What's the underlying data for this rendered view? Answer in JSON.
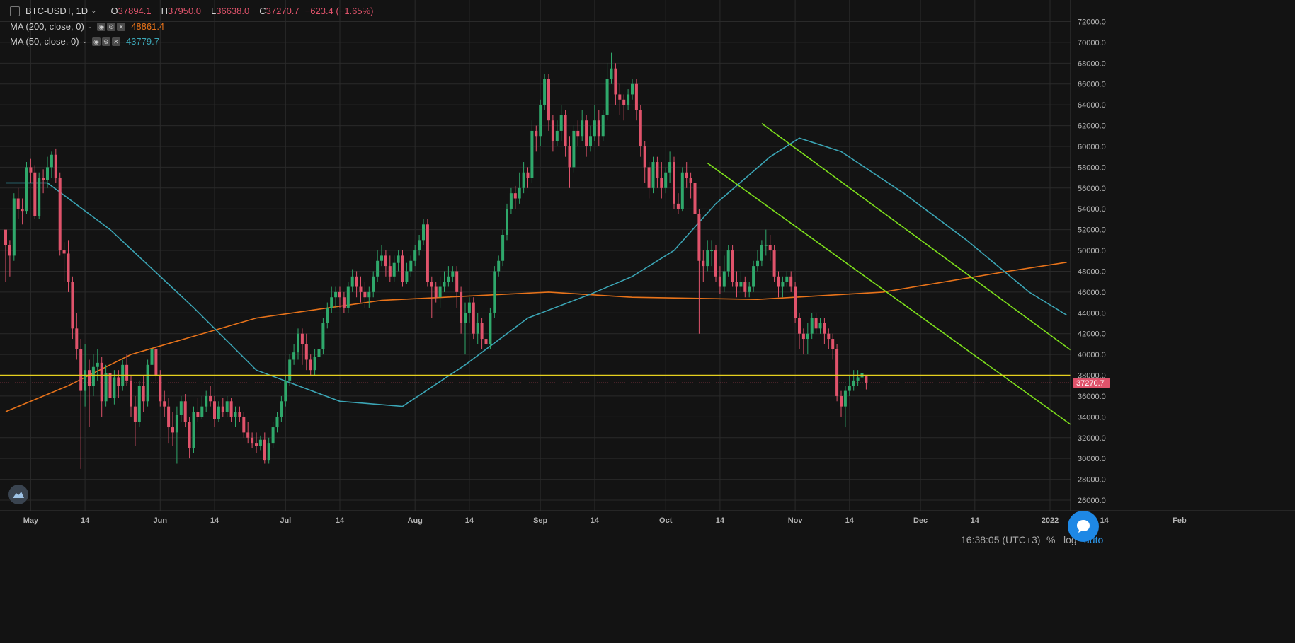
{
  "header": {
    "symbol": "BTC-USDT, 1D",
    "chevron": "⌄",
    "o_label": "O",
    "o_value": "37894.1",
    "h_label": "H",
    "h_value": "37950.0",
    "l_label": "L",
    "l_value": "36638.0",
    "c_label": "C",
    "c_value": "37270.7",
    "change": "−623.4 (−1.65%)"
  },
  "indicators": [
    {
      "name": "MA (200, close, 0)",
      "value": "48861.4",
      "color": "#e8731a"
    },
    {
      "name": "MA (50, close, 0)",
      "value": "43779.7",
      "color": "#3ba5b5"
    }
  ],
  "footer": {
    "time": "16:38:05 (UTC+3)",
    "percent": "%",
    "log": "log",
    "auto": "auto"
  },
  "chart_data": {
    "type": "candlestick",
    "symbol": "BTC-USDT",
    "interval": "1D",
    "ylim": [
      25000,
      73000
    ],
    "y_ticks": [
      "26000.0",
      "28000.0",
      "30000.0",
      "32000.0",
      "34000.0",
      "36000.0",
      "38000.0",
      "40000.0",
      "42000.0",
      "44000.0",
      "46000.0",
      "48000.0",
      "50000.0",
      "52000.0",
      "54000.0",
      "56000.0",
      "58000.0",
      "60000.0",
      "62000.0",
      "64000.0",
      "66000.0",
      "68000.0",
      "70000.0",
      "72000.0"
    ],
    "x_ticks": [
      "May",
      "14",
      "Jun",
      "14",
      "Jul",
      "14",
      "Aug",
      "14",
      "Sep",
      "14",
      "Oct",
      "14",
      "Nov",
      "14",
      "Dec",
      "14",
      "2022",
      "14",
      "Feb"
    ],
    "grid": true,
    "last_price_label": "37270.7",
    "last_price": 37270.7,
    "horizontal_level": 38000,
    "up_color": "#2fa86b",
    "down_color": "#e0536b",
    "candles": [
      [
        52000,
        50500,
        51800,
        47000
      ],
      [
        50500,
        49500,
        51000,
        47500
      ],
      [
        49500,
        55000,
        55500,
        49000
      ],
      [
        55000,
        54000,
        56000,
        53000
      ],
      [
        54000,
        53800,
        55000,
        52500
      ],
      [
        53800,
        58000,
        58500,
        53500
      ],
      [
        58000,
        57500,
        58800,
        56500
      ],
      [
        57500,
        53300,
        58200,
        53000
      ],
      [
        53300,
        57000,
        57500,
        53000
      ],
      [
        57000,
        56800,
        57800,
        55500
      ],
      [
        56800,
        58000,
        59000,
        56000
      ],
      [
        58000,
        59200,
        59500,
        57000
      ],
      [
        59200,
        57000,
        59800,
        56500
      ],
      [
        57000,
        50000,
        57500,
        49500
      ],
      [
        50000,
        49700,
        50800,
        47000
      ],
      [
        49700,
        47000,
        51000,
        46000
      ],
      [
        47000,
        42500,
        47500,
        41500
      ],
      [
        42500,
        40500,
        44000,
        39500
      ],
      [
        40500,
        36500,
        41500,
        29000
      ],
      [
        36500,
        38500,
        41000,
        35000
      ],
      [
        38500,
        37000,
        39500,
        33000
      ],
      [
        37000,
        38800,
        40000,
        36000
      ],
      [
        38800,
        39200,
        40500,
        37500
      ],
      [
        39200,
        35500,
        39800,
        34000
      ],
      [
        35500,
        38200,
        39000,
        35000
      ],
      [
        38200,
        35800,
        39000,
        35000
      ],
      [
        35800,
        37800,
        38500,
        35200
      ],
      [
        37800,
        37000,
        38500,
        35800
      ],
      [
        37000,
        39000,
        39500,
        36500
      ],
      [
        39000,
        37500,
        40000,
        37000
      ],
      [
        37500,
        35000,
        38000,
        34000
      ],
      [
        35000,
        33500,
        36000,
        31200
      ],
      [
        33500,
        37000,
        37500,
        33000
      ],
      [
        37000,
        35500,
        38000,
        34500
      ],
      [
        35500,
        39000,
        39500,
        35000
      ],
      [
        39000,
        40500,
        41000,
        38000
      ],
      [
        40500,
        38000,
        40800,
        37500
      ],
      [
        38000,
        35500,
        38500,
        35000
      ],
      [
        35500,
        35000,
        36500,
        34000
      ],
      [
        35000,
        33000,
        35800,
        31500
      ],
      [
        33000,
        32500,
        34500,
        31200
      ],
      [
        32500,
        34200,
        35000,
        29500
      ],
      [
        34200,
        35500,
        36000,
        33500
      ],
      [
        35500,
        33500,
        36200,
        33000
      ],
      [
        33500,
        31000,
        34000,
        30000
      ],
      [
        31000,
        34500,
        35000,
        30500
      ],
      [
        34500,
        34000,
        35800,
        33500
      ],
      [
        34000,
        35000,
        36000,
        33800
      ],
      [
        35000,
        36000,
        36500,
        34500
      ],
      [
        36000,
        35500,
        37000,
        35000
      ],
      [
        35500,
        33800,
        36000,
        33000
      ],
      [
        33800,
        35000,
        35500,
        33500
      ],
      [
        35000,
        34500,
        35800,
        34000
      ],
      [
        34500,
        35500,
        36000,
        34000
      ],
      [
        35500,
        34000,
        35800,
        33500
      ],
      [
        34000,
        34500,
        35000,
        33000
      ],
      [
        34500,
        34000,
        35000,
        33500
      ],
      [
        34000,
        32500,
        34500,
        32000
      ],
      [
        32500,
        32000,
        33500,
        31500
      ],
      [
        32000,
        31500,
        32500,
        31000
      ],
      [
        31500,
        31200,
        32500,
        30500
      ],
      [
        31200,
        31800,
        32200,
        30800
      ],
      [
        31800,
        29800,
        32500,
        29500
      ],
      [
        29800,
        31500,
        32000,
        29500
      ],
      [
        31500,
        33000,
        33500,
        31000
      ],
      [
        33000,
        34000,
        34500,
        32500
      ],
      [
        34000,
        35500,
        36000,
        33500
      ],
      [
        35500,
        37500,
        38000,
        35000
      ],
      [
        37500,
        39500,
        40000,
        37000
      ],
      [
        39500,
        40200,
        41000,
        39000
      ],
      [
        40200,
        42000,
        42500,
        39500
      ],
      [
        42000,
        41000,
        42500,
        39000
      ],
      [
        41000,
        39500,
        42000,
        38500
      ],
      [
        39500,
        38500,
        40000,
        38000
      ],
      [
        38500,
        39800,
        40500,
        38000
      ],
      [
        39800,
        40500,
        41000,
        37500
      ],
      [
        40500,
        43000,
        43500,
        40000
      ],
      [
        43000,
        44500,
        45000,
        42500
      ],
      [
        44500,
        45500,
        46500,
        44000
      ],
      [
        45500,
        46000,
        46500,
        44500
      ],
      [
        46000,
        45500,
        46500,
        44500
      ],
      [
        45500,
        44500,
        46000,
        44000
      ],
      [
        44500,
        46500,
        47000,
        44000
      ],
      [
        46500,
        47500,
        48200,
        46000
      ],
      [
        47500,
        46500,
        48000,
        45500
      ],
      [
        46500,
        46000,
        47500,
        45000
      ],
      [
        46000,
        45500,
        47000,
        44500
      ],
      [
        45500,
        46000,
        46500,
        44500
      ],
      [
        46000,
        47500,
        48000,
        45500
      ],
      [
        47500,
        49000,
        50000,
        47000
      ],
      [
        49000,
        49500,
        50500,
        48500
      ],
      [
        49500,
        48500,
        50000,
        47500
      ],
      [
        48500,
        47500,
        49500,
        47000
      ],
      [
        47500,
        48800,
        49500,
        47000
      ],
      [
        48800,
        49500,
        50000,
        48000
      ],
      [
        49500,
        47000,
        50000,
        46500
      ],
      [
        47000,
        48000,
        48800,
        46800
      ],
      [
        48000,
        49000,
        49500,
        47500
      ],
      [
        49000,
        50000,
        50500,
        48500
      ],
      [
        50000,
        51000,
        51500,
        49500
      ],
      [
        51000,
        52500,
        53000,
        50500
      ],
      [
        52500,
        47000,
        53000,
        46500
      ],
      [
        47000,
        46500,
        47500,
        43500
      ],
      [
        46500,
        45500,
        47000,
        45000
      ],
      [
        45500,
        46500,
        47500,
        44500
      ],
      [
        46500,
        47000,
        48000,
        46000
      ],
      [
        47000,
        47500,
        48500,
        46500
      ],
      [
        47500,
        48000,
        48500,
        47000
      ],
      [
        48000,
        46000,
        48500,
        44500
      ],
      [
        46000,
        43000,
        46500,
        42000
      ],
      [
        43000,
        44000,
        45000,
        40000
      ],
      [
        44000,
        45000,
        45500,
        43000
      ],
      [
        45000,
        42000,
        45500,
        41500
      ],
      [
        42000,
        43000,
        44000,
        41000
      ],
      [
        43000,
        41500,
        43500,
        40500
      ],
      [
        41500,
        41000,
        42500,
        40500
      ],
      [
        41000,
        44000,
        44500,
        40500
      ],
      [
        44000,
        48000,
        48500,
        43500
      ],
      [
        48000,
        49000,
        49500,
        47500
      ],
      [
        49000,
        51500,
        52000,
        48500
      ],
      [
        51500,
        54000,
        54500,
        51000
      ],
      [
        54000,
        55500,
        56000,
        53500
      ],
      [
        55500,
        55000,
        56200,
        54000
      ],
      [
        55000,
        56000,
        57500,
        54500
      ],
      [
        56000,
        57500,
        58500,
        55500
      ],
      [
        57500,
        57000,
        58000,
        56000
      ],
      [
        57000,
        61500,
        62500,
        56500
      ],
      [
        61500,
        61000,
        62000,
        59500
      ],
      [
        61000,
        64000,
        64500,
        60000
      ],
      [
        64000,
        66500,
        67000,
        63500
      ],
      [
        66500,
        62500,
        67000,
        61500
      ],
      [
        62500,
        60500,
        63000,
        59500
      ],
      [
        60500,
        61500,
        62500,
        60000
      ],
      [
        61500,
        63000,
        64000,
        60500
      ],
      [
        63000,
        60000,
        63500,
        59000
      ],
      [
        60000,
        58000,
        61000,
        56000
      ],
      [
        58000,
        61500,
        62000,
        57500
      ],
      [
        61500,
        61000,
        62500,
        60000
      ],
      [
        61000,
        62500,
        63500,
        60500
      ],
      [
        62500,
        60000,
        63000,
        59000
      ],
      [
        60000,
        61000,
        62000,
        59500
      ],
      [
        61000,
        62500,
        64000,
        60500
      ],
      [
        62500,
        61000,
        63500,
        60000
      ],
      [
        61000,
        63000,
        63500,
        60500
      ],
      [
        63000,
        66500,
        68000,
        62500
      ],
      [
        66500,
        67500,
        69000,
        66000
      ],
      [
        67500,
        65000,
        68000,
        64000
      ],
      [
        65000,
        64500,
        66000,
        63000
      ],
      [
        64500,
        64000,
        65000,
        62500
      ],
      [
        64000,
        65000,
        65500,
        63500
      ],
      [
        65000,
        66000,
        66500,
        64500
      ],
      [
        66000,
        63500,
        66500,
        62500
      ],
      [
        63500,
        60000,
        64000,
        59000
      ],
      [
        60000,
        58000,
        60500,
        56500
      ],
      [
        58000,
        56000,
        58500,
        55000
      ],
      [
        56000,
        58500,
        59000,
        55500
      ],
      [
        58500,
        57000,
        59000,
        56000
      ],
      [
        57000,
        56000,
        58500,
        55000
      ],
      [
        56000,
        57500,
        58000,
        55500
      ],
      [
        57500,
        58500,
        59500,
        56500
      ],
      [
        58500,
        54500,
        59000,
        54000
      ],
      [
        54500,
        54000,
        55500,
        53500
      ],
      [
        54000,
        57500,
        58000,
        53800
      ],
      [
        57500,
        57000,
        58500,
        56000
      ],
      [
        57000,
        56500,
        57500,
        55000
      ],
      [
        56500,
        53500,
        57000,
        52000
      ],
      [
        53500,
        49000,
        54000,
        42000
      ],
      [
        49000,
        48500,
        50000,
        47000
      ],
      [
        48500,
        50000,
        51000,
        48000
      ],
      [
        50000,
        50000,
        51000,
        48500
      ],
      [
        50000,
        47500,
        50500,
        47000
      ],
      [
        47500,
        46500,
        48500,
        45800
      ],
      [
        46500,
        48000,
        49500,
        46000
      ],
      [
        48000,
        50000,
        50500,
        47500
      ],
      [
        50000,
        47000,
        50500,
        46500
      ],
      [
        47000,
        46500,
        48000,
        45500
      ],
      [
        46500,
        47000,
        48000,
        46000
      ],
      [
        47000,
        46000,
        47500,
        45500
      ],
      [
        46000,
        46500,
        47000,
        45500
      ],
      [
        46500,
        48500,
        49000,
        46000
      ],
      [
        48500,
        49000,
        50000,
        48000
      ],
      [
        49000,
        50500,
        51000,
        48500
      ],
      [
        50500,
        50500,
        52000,
        49500
      ],
      [
        50500,
        50000,
        51500,
        49000
      ],
      [
        50000,
        47500,
        50500,
        47000
      ],
      [
        47500,
        46500,
        48000,
        45500
      ],
      [
        46500,
        47000,
        47500,
        45500
      ],
      [
        47000,
        47500,
        48000,
        46500
      ],
      [
        47500,
        46500,
        48000,
        46000
      ],
      [
        46500,
        43500,
        47000,
        43000
      ],
      [
        43500,
        42000,
        44000,
        40500
      ],
      [
        42000,
        41500,
        42500,
        40000
      ],
      [
        41500,
        42000,
        43000,
        40000
      ],
      [
        42000,
        43500,
        44000,
        41500
      ],
      [
        43500,
        42500,
        44000,
        42000
      ],
      [
        42500,
        43000,
        43500,
        42000
      ],
      [
        43000,
        42000,
        43500,
        41000
      ],
      [
        42000,
        41500,
        42500,
        40500
      ],
      [
        41500,
        40500,
        42000,
        39500
      ],
      [
        40500,
        36000,
        41000,
        35500
      ],
      [
        36000,
        35000,
        36500,
        34000
      ],
      [
        35000,
        36500,
        37000,
        33000
      ],
      [
        36500,
        37000,
        38000,
        36000
      ],
      [
        37000,
        37500,
        38500,
        36500
      ],
      [
        37500,
        37800,
        38500,
        37000
      ],
      [
        37800,
        38200,
        38800,
        37500
      ],
      [
        37894.1,
        37270.7,
        37950,
        36638
      ]
    ],
    "ma200": [
      [
        0,
        34500
      ],
      [
        15,
        37000
      ],
      [
        30,
        40000
      ],
      [
        60,
        43500
      ],
      [
        90,
        45200
      ],
      [
        120,
        45800
      ],
      [
        130,
        46000
      ],
      [
        150,
        45500
      ],
      [
        180,
        45300
      ],
      [
        210,
        46000
      ],
      [
        240,
        48000
      ],
      [
        254,
        48861
      ]
    ],
    "ma50": [
      [
        0,
        56500
      ],
      [
        10,
        56500
      ],
      [
        25,
        52000
      ],
      [
        45,
        44500
      ],
      [
        60,
        38500
      ],
      [
        80,
        35500
      ],
      [
        95,
        35000
      ],
      [
        110,
        39000
      ],
      [
        125,
        43500
      ],
      [
        140,
        45800
      ],
      [
        150,
        47500
      ],
      [
        160,
        50000
      ],
      [
        170,
        54500
      ],
      [
        183,
        59000
      ],
      [
        190,
        60800
      ],
      [
        200,
        59500
      ],
      [
        215,
        55500
      ],
      [
        230,
        51000
      ],
      [
        245,
        46000
      ],
      [
        254,
        43780
      ]
    ],
    "trendlines": [
      {
        "from": [
          181,
          62200
        ],
        "to": [
          272,
          35400
        ],
        "color": "#7ee01c"
      },
      {
        "from": [
          168,
          58400
        ],
        "to": [
          260,
          31800
        ],
        "color": "#7ee01c"
      }
    ]
  }
}
